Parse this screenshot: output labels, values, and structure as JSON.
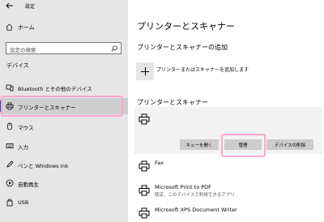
{
  "window": {
    "title": "設定"
  },
  "sidebar": {
    "home_label": "ホーム",
    "search_placeholder": "設定の検索",
    "section_label": "デバイス",
    "items": [
      {
        "label": "Bluetooth とその他のデバイス",
        "icon": "bluetooth-devices-icon"
      },
      {
        "label": "プリンターとスキャナー",
        "icon": "printer-icon",
        "selected": true
      },
      {
        "label": "マウス",
        "icon": "mouse-icon"
      },
      {
        "label": "入力",
        "icon": "keyboard-icon"
      },
      {
        "label": "ペンと Windows Ink",
        "icon": "pen-icon"
      },
      {
        "label": "自動再生",
        "icon": "autoplay-icon"
      },
      {
        "label": "USB",
        "icon": "usb-icon"
      }
    ]
  },
  "main": {
    "title": "プリンターとスキャナー",
    "add_section": {
      "heading": "プリンターとスキャナーの追加",
      "add_label": "プリンターまたはスキャナーを追加します"
    },
    "printers_section": {
      "heading": "プリンターとスキャナー",
      "selected_card": {
        "buttons": {
          "open_queue": "キューを開く",
          "manage": "管理",
          "remove": "デバイスの削除"
        }
      },
      "list": [
        {
          "name": "Fax",
          "sub": ""
        },
        {
          "name": "Microsoft Print to PDF",
          "sub": "既定、このデバイスで利用できるアプリ"
        },
        {
          "name": "Microsoft XPS Document Writer",
          "sub": ""
        }
      ]
    }
  },
  "colors": {
    "sidebar_bg": "#e6e6e6",
    "selected_bg": "#cfcfcf",
    "accent": "#0063b1",
    "highlight": "#ffa6d0",
    "card_bg": "#f2f2f2",
    "button_bg": "#cccccc"
  }
}
